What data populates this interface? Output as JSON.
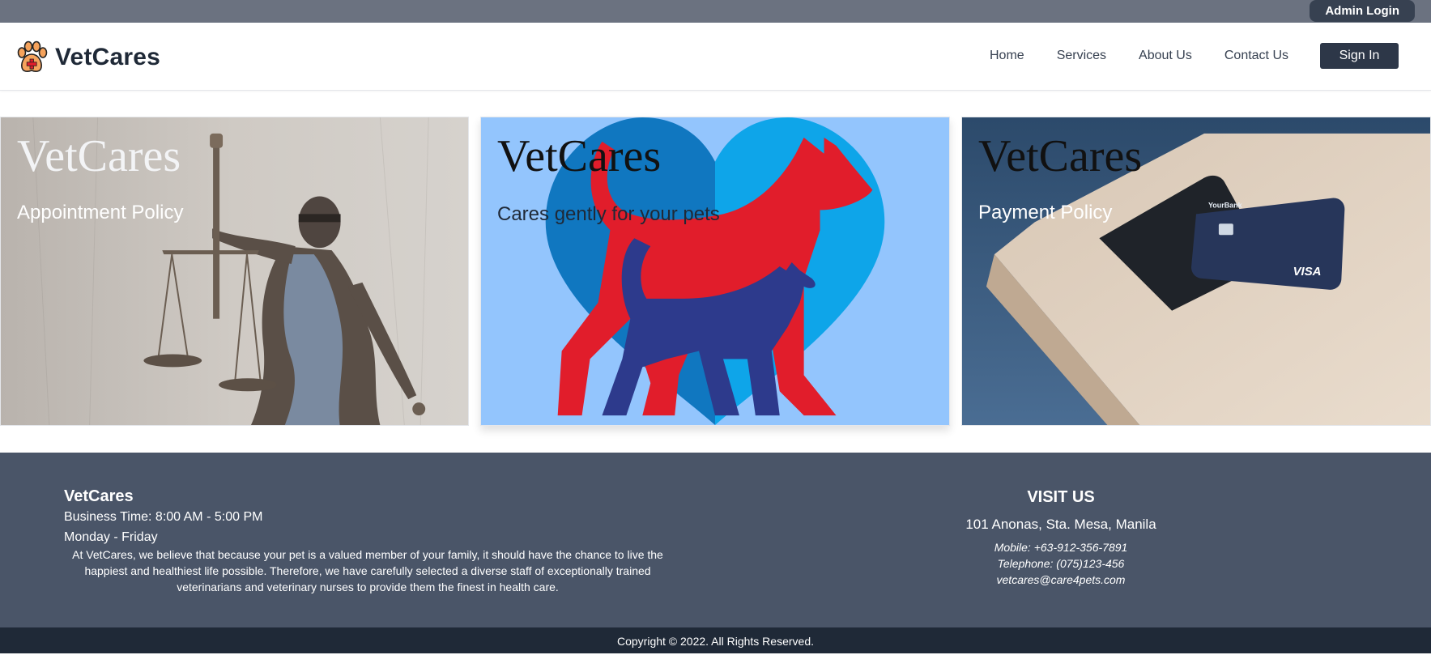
{
  "topbar": {
    "admin_login": "Admin Login"
  },
  "navbar": {
    "brand": "VetCares",
    "links": [
      "Home",
      "Services",
      "About Us",
      "Contact Us"
    ],
    "signin": "Sign In"
  },
  "cards": [
    {
      "title": "VetCares",
      "subtitle": "Appointment Policy"
    },
    {
      "title": "VetCares",
      "subtitle": "Cares gently for your pets"
    },
    {
      "title": "VetCares",
      "subtitle": "Payment Policy"
    }
  ],
  "footer": {
    "title": "VetCares",
    "business_time": "Business Time: 8:00 AM - 5:00 PM",
    "days": "Monday - Friday",
    "about": "At VetCares, we believe that because your pet is a valued member of your family, it should have the chance to live the happiest and healthiest life possible. Therefore, we have carefully selected a diverse staff of exceptionally trained veterinarians and veterinary nurses to provide them the finest in health care.",
    "visit_title": "VISIT US",
    "address": "101 Anonas, Sta. Mesa, Manila",
    "mobile": "Mobile: +63-912-356-7891",
    "telephone": "Telephone: (075)123-456",
    "email": "vetcares@care4pets.com"
  },
  "copyright": "Copyright © 2022. All Rights Reserved.",
  "card3_bank_label": "YourBank",
  "card3_card_brand": "VISA",
  "colors": {
    "topbar": "#6b7280",
    "nav_button": "#2d3748",
    "footer": "#4a5568",
    "copyright_bar": "#1f2937",
    "heart_dark": "#1077c0",
    "heart_light": "#0ea5e9",
    "dog": "#e11d2b",
    "cat": "#2d3a8c"
  }
}
